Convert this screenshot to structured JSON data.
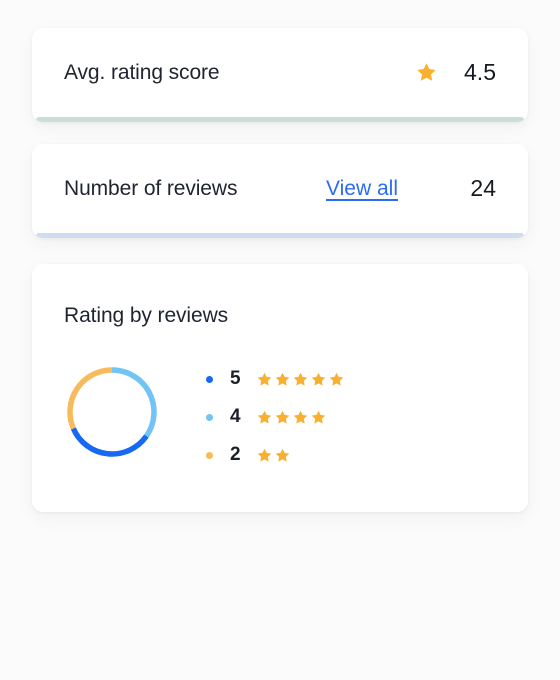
{
  "theme": {
    "page_background": "#FBFBFC",
    "card_background": "#FFFFFF",
    "text_primary": "#1F2430",
    "star_gold": "#F8B02E",
    "link_blue": "#2B6CF6",
    "accent_green": "#CBDED5",
    "accent_blue": "#CFDDEE",
    "donut_dark_blue": "#1569F2",
    "donut_light_blue": "#72C3F6",
    "donut_amber": "#F8BB5C"
  },
  "cards": {
    "avg_rating": {
      "label": "Avg. rating score",
      "star_icon": "star-icon",
      "value": "4.5",
      "accent_color": "#CBDED5"
    },
    "number_of_reviews": {
      "label": "Number of reviews",
      "link_label": "View all",
      "value": "24",
      "accent_color": "#CFDDEE"
    },
    "rating_by_reviews": {
      "title": "Rating by reviews"
    }
  },
  "chart_data": {
    "type": "pie",
    "title": "Rating by reviews",
    "subtype": "donut",
    "categories": [
      "5",
      "4",
      "2"
    ],
    "values": [
      34,
      35,
      31
    ],
    "colors": [
      "#1569F2",
      "#72C3F6",
      "#F8BB5C"
    ],
    "legend_position": "right",
    "start_angle_deg": 0,
    "direction": "clockwise",
    "segments": [
      {
        "label": "4",
        "stars": 4,
        "color": "#72C3F6",
        "start_deg": 0,
        "end_deg": 125
      },
      {
        "label": "5",
        "stars": 5,
        "color": "#1569F2",
        "start_deg": 125,
        "end_deg": 247
      },
      {
        "label": "2",
        "stars": 2,
        "color": "#F8BB5C",
        "start_deg": 247,
        "end_deg": 360
      }
    ],
    "legend": [
      {
        "score": "5",
        "stars": 5,
        "dot_color": "#1569F2"
      },
      {
        "score": "4",
        "stars": 4,
        "dot_color": "#72C3F6"
      },
      {
        "score": "2",
        "stars": 2,
        "dot_color": "#F8BB5C"
      }
    ]
  }
}
